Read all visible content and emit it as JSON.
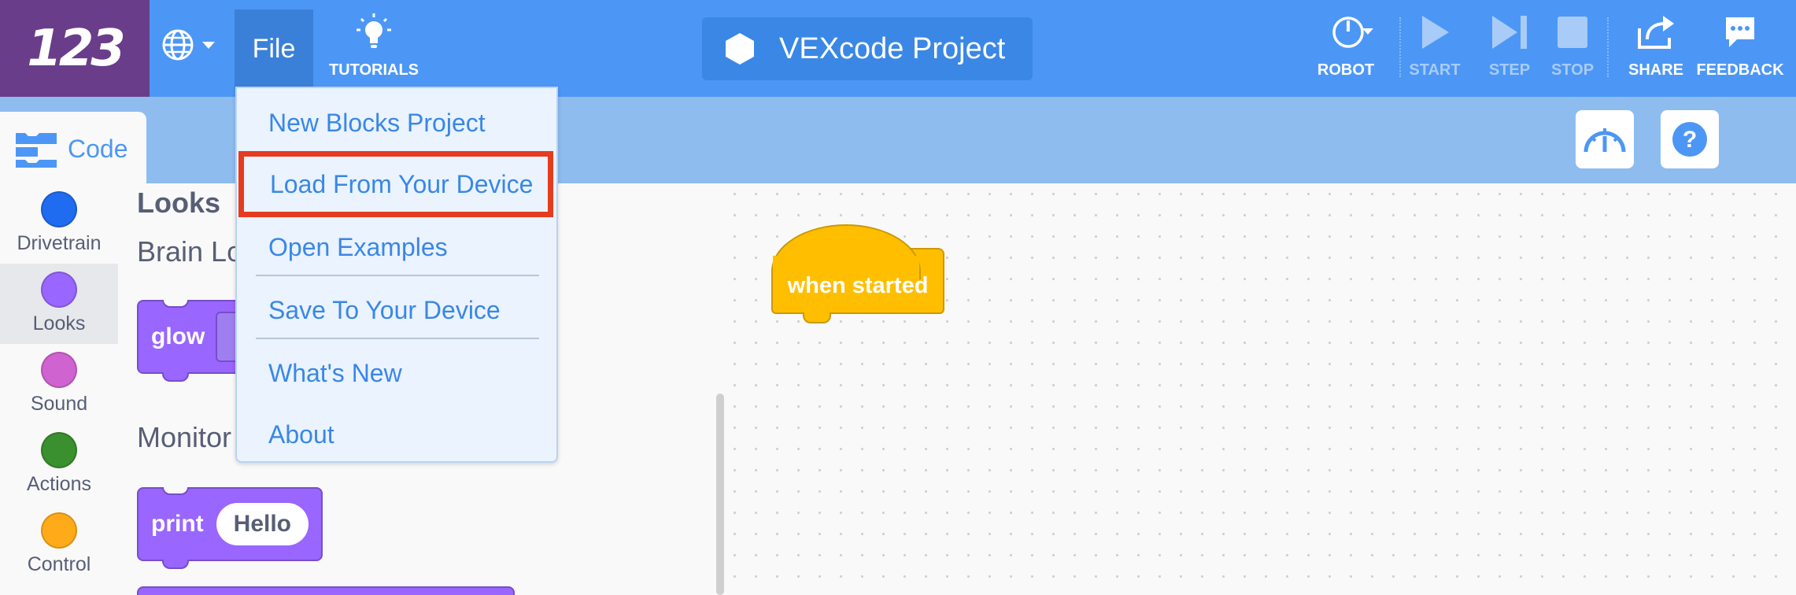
{
  "app": {
    "logo_text": "123"
  },
  "menubar": {
    "file_label": "File",
    "tutorials_label": "TUTORIALS",
    "project_name": "VEXcode Project",
    "robot_label": "ROBOT",
    "start_label": "START",
    "step_label": "STEP",
    "stop_label": "STOP",
    "share_label": "SHARE",
    "feedback_label": "FEEDBACK"
  },
  "code_tab": {
    "label": "Code"
  },
  "file_menu": {
    "items": [
      {
        "label": "New Blocks Project",
        "highlighted": false
      },
      {
        "label": "Load From Your Device",
        "highlighted": true
      },
      {
        "label": "Open Examples",
        "highlighted": false
      },
      {
        "label": "Save To Your Device",
        "highlighted": false
      },
      {
        "label": "What's New",
        "highlighted": false
      },
      {
        "label": "About",
        "highlighted": false
      }
    ]
  },
  "categories": [
    {
      "label": "Drivetrain",
      "color": "#1f6cf0",
      "active": false
    },
    {
      "label": "Looks",
      "color": "#9966ff",
      "active": true
    },
    {
      "label": "Sound",
      "color": "#cf63cf",
      "active": false
    },
    {
      "label": "Actions",
      "color": "#3a8f2e",
      "active": false
    },
    {
      "label": "Control",
      "color": "#ffab19",
      "active": false
    }
  ],
  "palette": {
    "section_title": "Looks",
    "subsection_1": "Brain Lo",
    "subsection_2": "Monitor L",
    "glow_block": {
      "label": "glow"
    },
    "print_block": {
      "label": "print",
      "value": "Hello"
    }
  },
  "workspace": {
    "hat_block": {
      "label": "when started"
    }
  },
  "colors": {
    "topbar": "#4c97f5",
    "logo_bg": "#6a3d8a",
    "looks": "#9966ff",
    "events": "#ffbf00",
    "highlight_box": "#e63b1f"
  }
}
